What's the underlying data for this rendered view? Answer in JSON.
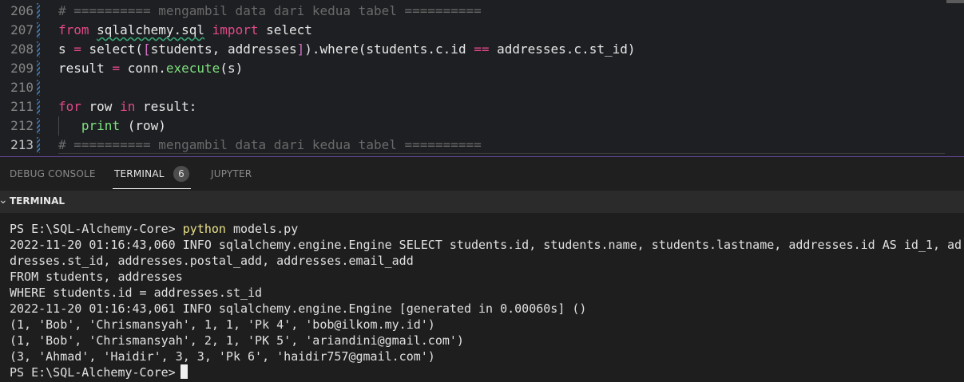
{
  "editor": {
    "lines": [
      {
        "num": "206",
        "segments": [
          {
            "t": "# ========== mengambil data dari kedua tabel ==========",
            "c": "cmt"
          }
        ]
      },
      {
        "num": "207",
        "segments": [
          {
            "t": "from ",
            "c": "kw"
          },
          {
            "t": "sqlalchemy.sql",
            "c": "mod"
          },
          {
            "t": " import ",
            "c": "kw"
          },
          {
            "t": "select",
            "c": "pl"
          }
        ]
      },
      {
        "num": "208",
        "segments": [
          {
            "t": "s ",
            "c": "pl"
          },
          {
            "t": "=",
            "c": "op"
          },
          {
            "t": " select(",
            "c": "pl"
          },
          {
            "t": "[",
            "c": "br"
          },
          {
            "t": "students, addresses",
            "c": "pl"
          },
          {
            "t": "]",
            "c": "br"
          },
          {
            "t": ").where(students.c.id ",
            "c": "pl"
          },
          {
            "t": "==",
            "c": "op"
          },
          {
            "t": " addresses.c.st_id)",
            "c": "pl"
          }
        ]
      },
      {
        "num": "209",
        "segments": [
          {
            "t": "result ",
            "c": "pl"
          },
          {
            "t": "=",
            "c": "op"
          },
          {
            "t": " conn.",
            "c": "pl"
          },
          {
            "t": "execute",
            "c": "fn"
          },
          {
            "t": "(s)",
            "c": "pl"
          }
        ]
      },
      {
        "num": "210",
        "segments": []
      },
      {
        "num": "211",
        "segments": [
          {
            "t": "for",
            "c": "kw"
          },
          {
            "t": " row ",
            "c": "pl"
          },
          {
            "t": "in",
            "c": "kw"
          },
          {
            "t": " result:",
            "c": "pl"
          }
        ]
      },
      {
        "num": "212",
        "segments": [
          {
            "t": "   ",
            "c": "pl"
          },
          {
            "t": "print",
            "c": "fn"
          },
          {
            "t": " (row)",
            "c": "pl"
          }
        ]
      },
      {
        "num": "213",
        "segments": [
          {
            "t": "# ========== mengambil data dari kedua tabel ==========",
            "c": "cmt"
          }
        ]
      }
    ]
  },
  "panel": {
    "tabs": [
      {
        "label": "DEBUG CONSOLE",
        "active": false
      },
      {
        "label": "TERMINAL",
        "active": true,
        "badge": "6"
      },
      {
        "label": "JUPYTER",
        "active": false
      }
    ],
    "terminal_title": "TERMINAL"
  },
  "terminal": {
    "prompt": "PS E:\\SQL-Alchemy-Core>",
    "command": "python",
    "command_args": " models.py",
    "output": [
      "2022-11-20 01:16:43,060 INFO sqlalchemy.engine.Engine SELECT students.id, students.name, students.lastname, addresses.id AS id_1, ad",
      "dresses.st_id, addresses.postal_add, addresses.email_add",
      "FROM students, addresses",
      "WHERE students.id = addresses.st_id",
      "2022-11-20 01:16:43,061 INFO sqlalchemy.engine.Engine [generated in 0.00060s] ()",
      "(1, 'Bob', 'Chrismansyah', 1, 1, 'Pk 4', 'bob@ilkom.my.id')",
      "(1, 'Bob', 'Chrismansyah', 2, 1, 'PK 5', 'ariandini@gmail.com')",
      "(3, 'Ahmad', 'Haidir', 3, 3, 'Pk 6', 'haidir757@gmail.com')"
    ],
    "final_prompt": "PS E:\\SQL-Alchemy-Core>"
  }
}
